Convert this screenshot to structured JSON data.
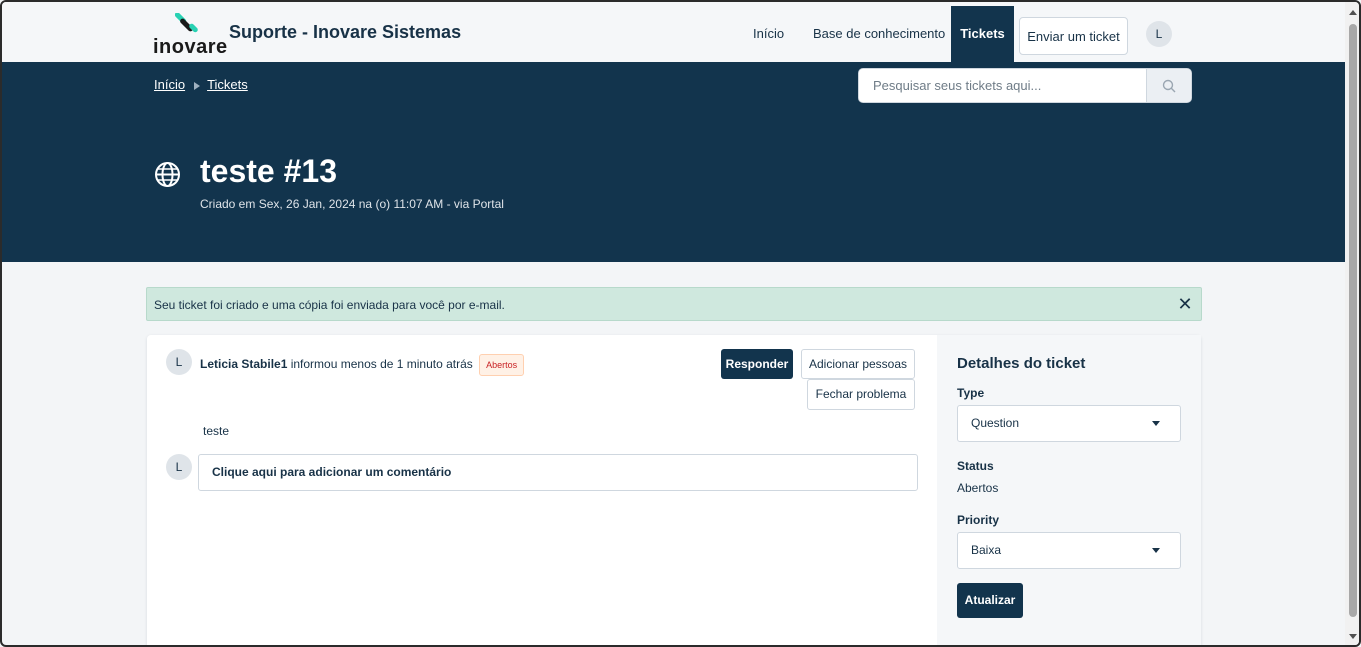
{
  "header": {
    "logo_text": "inovare",
    "brand": "Suporte - Inovare Sistemas",
    "nav": {
      "home": "Início",
      "knowledge": "Base de conhecimento",
      "tickets": "Tickets",
      "submit": "Enviar um ticket"
    },
    "user_initial": "L"
  },
  "hero": {
    "breadcrumb": [
      "Início",
      "Tickets"
    ],
    "search_placeholder": "Pesquisar seus tickets aqui...",
    "title": "teste #13",
    "meta": "Criado em Sex, 26 Jan, 2024 na (o) 11:07 AM - via Portal"
  },
  "alert": {
    "text": "Seu ticket foi criado e uma cópia foi enviada para você por e-mail.",
    "close": "✕"
  },
  "conversation": {
    "avatar_initial": "L",
    "author": "Leticia Stabile1",
    "action": " informou menos de 1 minuto atrás",
    "status_badge": "Abertos",
    "reply": "Responder",
    "add_people": "Adicionar pessoas",
    "close_problem": "Fechar problema",
    "message": "teste",
    "comment_prompt": "Clique aqui para adicionar um comentário"
  },
  "details": {
    "title": "Detalhes do ticket",
    "type_label": "Type",
    "type_value": "Question",
    "status_label": "Status",
    "status_value": "Abertos",
    "priority_label": "Priority",
    "priority_value": "Baixa",
    "update_button": "Atualizar"
  },
  "colors": {
    "primary": "#12344d",
    "alert_bg": "#cfe8de",
    "badge_text": "#c82124"
  }
}
